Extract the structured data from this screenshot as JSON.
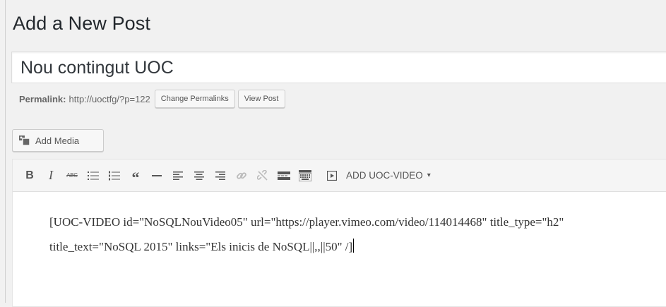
{
  "page": {
    "title": "Add a New Post"
  },
  "post": {
    "title_value": "Nou contingut UOC",
    "permalink_label": "Permalink:",
    "permalink_url": "http://uoctfg/?p=122",
    "change_permalinks_label": "Change Permalinks",
    "view_post_label": "View Post"
  },
  "media": {
    "add_media_label": "Add Media"
  },
  "toolbar": {
    "bold_label": "B",
    "italic_label": "I",
    "strike_label": "ABC",
    "blockquote_label": "“",
    "uoc_video_label": "ADD UOC-VIDEO",
    "caret": "▾",
    "buttons": [
      "bold-icon",
      "italic-icon",
      "strikethrough-icon",
      "bullet-list-icon",
      "numbered-list-icon",
      "blockquote-icon",
      "horizontal-line-icon",
      "align-left-icon",
      "align-center-icon",
      "align-right-icon",
      "link-icon",
      "unlink-icon",
      "read-more-icon",
      "toolbar-toggle-icon",
      "video-icon"
    ]
  },
  "editor": {
    "content": "[UOC-VIDEO id=\"NoSQLNouVideo05\" url=\"https://player.vimeo.com/video/114014468\" title_type=\"h2\" title_text=\"NoSQL 2015\" links=\"Els inicis de NoSQL||,,||50\" /]"
  }
}
